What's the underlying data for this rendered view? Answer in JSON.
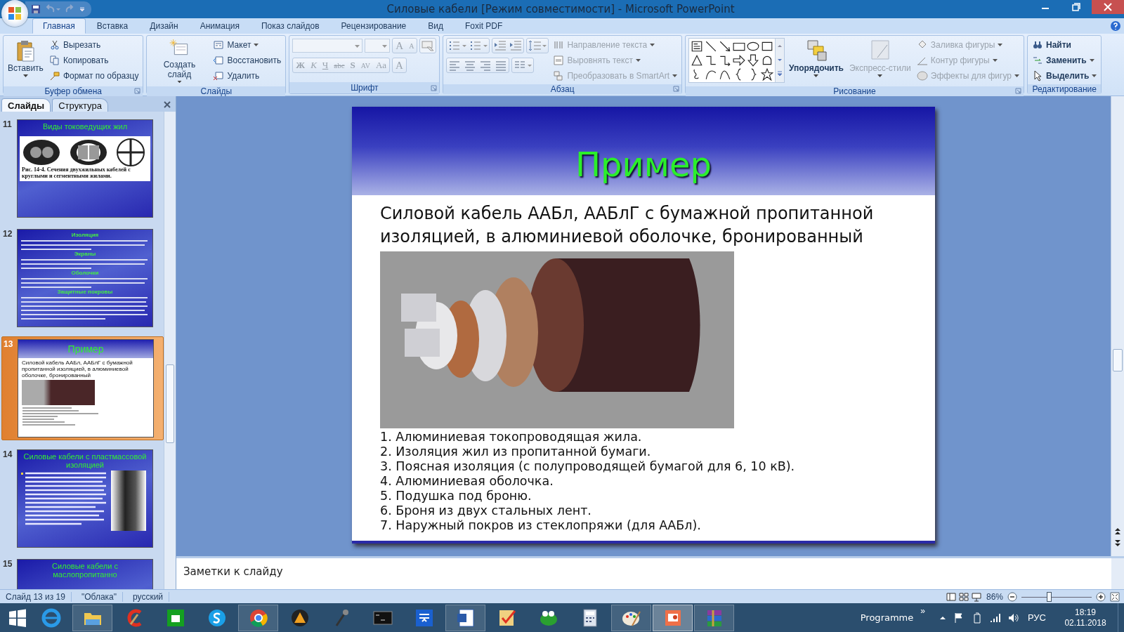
{
  "window": {
    "title": "Силовые кабели [Режим совместимости] - Microsoft PowerPoint"
  },
  "tabs": [
    {
      "label": "Главная",
      "selected": true
    },
    {
      "label": "Вставка",
      "selected": false
    },
    {
      "label": "Дизайн",
      "selected": false
    },
    {
      "label": "Анимация",
      "selected": false
    },
    {
      "label": "Показ слайдов",
      "selected": false
    },
    {
      "label": "Рецензирование",
      "selected": false
    },
    {
      "label": "Вид",
      "selected": false
    },
    {
      "label": "Foxit PDF",
      "selected": false
    }
  ],
  "ribbon": [
    {
      "kind": "clipboard",
      "label": "Буфер обмена",
      "large": [
        {
          "label": "Вставить",
          "dropdown": true,
          "disabled": false
        }
      ],
      "small": [
        {
          "label": "Вырезать",
          "dropdown": false,
          "disabled": false
        },
        {
          "label": "Копировать",
          "dropdown": false,
          "disabled": false
        },
        {
          "label": "Формат по образцу",
          "dropdown": false,
          "disabled": false
        }
      ]
    },
    {
      "kind": "slides",
      "label": "Слайды",
      "large": [
        {
          "label": "Создать слайд",
          "dropdown": true,
          "disabled": false
        }
      ],
      "small": [
        {
          "label": "Макет",
          "dropdown": true,
          "disabled": false
        },
        {
          "label": "Восстановить",
          "dropdown": false,
          "disabled": false
        },
        {
          "label": "Удалить",
          "dropdown": false,
          "disabled": false
        }
      ]
    },
    {
      "kind": "font",
      "label": "Шрифт",
      "size_buttons": [
        "A",
        "A"
      ],
      "format_buttons": [
        "Ж",
        "К",
        "Ч",
        "abc",
        "S",
        "AV",
        "Aa"
      ],
      "color_button": "A"
    },
    {
      "kind": "paragraph",
      "label": "Абзац",
      "small": [
        {
          "label": "Направление текста",
          "dropdown": true,
          "disabled": true
        },
        {
          "label": "Выровнять текст",
          "dropdown": true,
          "disabled": true
        },
        {
          "label": "Преобразовать в SmartArt",
          "dropdown": true,
          "disabled": true
        }
      ]
    },
    {
      "kind": "drawing",
      "label": "Рисование",
      "large": [
        {
          "label": "Упорядочить",
          "dropdown": true,
          "disabled": false
        },
        {
          "label": "Экспресс-стили",
          "dropdown": true,
          "disabled": true
        }
      ],
      "small": [
        {
          "label": "Заливка фигуры",
          "dropdown": true,
          "disabled": true
        },
        {
          "label": "Контур фигуры",
          "dropdown": true,
          "disabled": true
        },
        {
          "label": "Эффекты для фигур",
          "dropdown": true,
          "disabled": true
        }
      ]
    },
    {
      "kind": "editing",
      "label": "Редактирование",
      "small": [
        {
          "label": "Найти",
          "dropdown": false,
          "disabled": false
        },
        {
          "label": "Заменить",
          "dropdown": true,
          "disabled": false
        },
        {
          "label": "Выделить",
          "dropdown": true,
          "disabled": false
        }
      ]
    }
  ],
  "panel": {
    "tabs": [
      {
        "label": "Слайды",
        "selected": true
      },
      {
        "label": "Структура",
        "selected": false
      }
    ],
    "thumbnails": [
      {
        "number": "11",
        "selected": false,
        "kind": "figure",
        "title": "Виды токоведущих жил",
        "caption": "Рис. 14-4. Сечения двухжильных кабелей с круглыми и сегментными жилами."
      },
      {
        "number": "12",
        "selected": false,
        "kind": "sections",
        "headings": [
          "Изоляция",
          "Экраны",
          "Оболочки",
          "Защитные покровы"
        ]
      },
      {
        "number": "13",
        "selected": true,
        "kind": "example",
        "title": "Пример",
        "body": "Силовой кабель ААБл, ААБлГ с бумажной пропитанной изоляцией, в алюминиевой оболочке, бронированный"
      },
      {
        "number": "14",
        "selected": false,
        "kind": "bullets-photo",
        "title": "Силовые кабели с пластмассовой изоляцией"
      },
      {
        "number": "15",
        "selected": false,
        "kind": "title",
        "title": "Силовые кабели с маслопропитанно"
      }
    ]
  },
  "slide": {
    "title": "Пример",
    "body": "Силовой кабель ААБл, ААБлГ с бумажной пропитанной изоляцией, в алюминиевой оболочке, бронированный",
    "items": [
      "1. Алюминиевая токопроводящая жила.",
      "2. Изоляция жил из пропитанной бумаги.",
      "3. Поясная изоляция (с полупроводящей бумагой для 6, 10 кВ).",
      "4. Алюминиевая оболочка.",
      "5. Подушка под броню.",
      "6. Броня из двух стальных лент.",
      "7. Наружный покров из стеклопряжи (для ААБл)."
    ]
  },
  "notes": {
    "placeholder": "Заметки к слайду"
  },
  "status_bar": {
    "items": [
      "Слайд 13 из 19",
      "\"Облака\"",
      "русский"
    ],
    "zoom": "86%",
    "zoom_slider": {
      "level": 0.4
    }
  },
  "taskbar": {
    "apps": [
      {
        "kind": "ie",
        "open": false,
        "active": false
      },
      {
        "kind": "explorer",
        "open": true,
        "active": false
      },
      {
        "kind": "cleaner",
        "open": false,
        "active": false
      },
      {
        "kind": "store",
        "open": false,
        "active": false
      },
      {
        "kind": "skype",
        "open": false,
        "active": false
      },
      {
        "kind": "chrome",
        "open": true,
        "active": false
      },
      {
        "kind": "player",
        "open": false,
        "active": false
      },
      {
        "kind": "microphone",
        "open": false,
        "active": false
      },
      {
        "kind": "console",
        "open": false,
        "active": false
      },
      {
        "kind": "tools",
        "open": false,
        "active": false
      },
      {
        "kind": "word",
        "open": true,
        "active": false
      },
      {
        "kind": "checklist",
        "open": false,
        "active": false
      },
      {
        "kind": "frog",
        "open": false,
        "active": false
      },
      {
        "kind": "calculator",
        "open": false,
        "active": false
      },
      {
        "kind": "paint",
        "open": true,
        "active": false
      },
      {
        "kind": "powerpoint",
        "open": true,
        "active": true
      },
      {
        "kind": "archiver",
        "open": true,
        "active": false
      }
    ],
    "tray_label": "Programme",
    "tray_chevron": "»",
    "language": "РУС",
    "time": "18:19",
    "date": "02.11.2018"
  }
}
